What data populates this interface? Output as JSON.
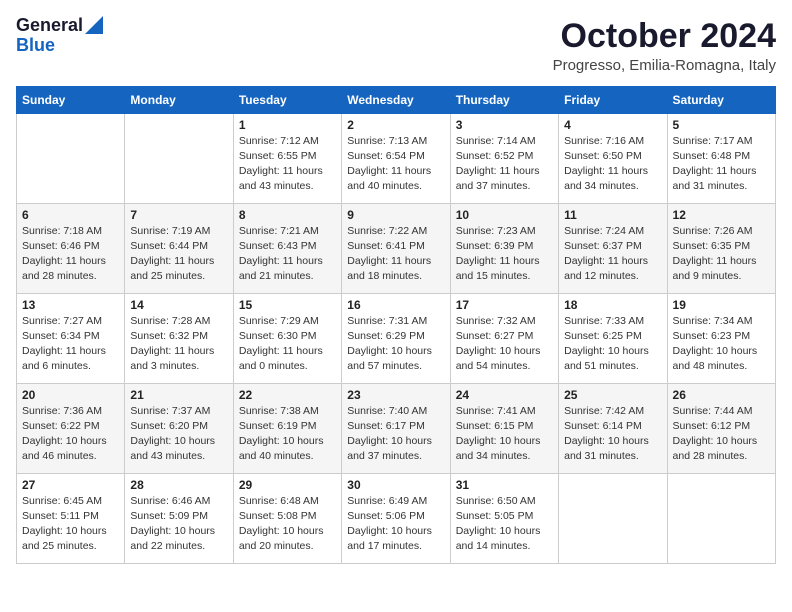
{
  "header": {
    "logo_general": "General",
    "logo_blue": "Blue",
    "month_title": "October 2024",
    "location": "Progresso, Emilia-Romagna, Italy"
  },
  "days_of_week": [
    "Sunday",
    "Monday",
    "Tuesday",
    "Wednesday",
    "Thursday",
    "Friday",
    "Saturday"
  ],
  "weeks": [
    [
      {
        "day": "",
        "sunrise": "",
        "sunset": "",
        "daylight": ""
      },
      {
        "day": "",
        "sunrise": "",
        "sunset": "",
        "daylight": ""
      },
      {
        "day": "1",
        "sunrise": "Sunrise: 7:12 AM",
        "sunset": "Sunset: 6:55 PM",
        "daylight": "Daylight: 11 hours and 43 minutes."
      },
      {
        "day": "2",
        "sunrise": "Sunrise: 7:13 AM",
        "sunset": "Sunset: 6:54 PM",
        "daylight": "Daylight: 11 hours and 40 minutes."
      },
      {
        "day": "3",
        "sunrise": "Sunrise: 7:14 AM",
        "sunset": "Sunset: 6:52 PM",
        "daylight": "Daylight: 11 hours and 37 minutes."
      },
      {
        "day": "4",
        "sunrise": "Sunrise: 7:16 AM",
        "sunset": "Sunset: 6:50 PM",
        "daylight": "Daylight: 11 hours and 34 minutes."
      },
      {
        "day": "5",
        "sunrise": "Sunrise: 7:17 AM",
        "sunset": "Sunset: 6:48 PM",
        "daylight": "Daylight: 11 hours and 31 minutes."
      }
    ],
    [
      {
        "day": "6",
        "sunrise": "Sunrise: 7:18 AM",
        "sunset": "Sunset: 6:46 PM",
        "daylight": "Daylight: 11 hours and 28 minutes."
      },
      {
        "day": "7",
        "sunrise": "Sunrise: 7:19 AM",
        "sunset": "Sunset: 6:44 PM",
        "daylight": "Daylight: 11 hours and 25 minutes."
      },
      {
        "day": "8",
        "sunrise": "Sunrise: 7:21 AM",
        "sunset": "Sunset: 6:43 PM",
        "daylight": "Daylight: 11 hours and 21 minutes."
      },
      {
        "day": "9",
        "sunrise": "Sunrise: 7:22 AM",
        "sunset": "Sunset: 6:41 PM",
        "daylight": "Daylight: 11 hours and 18 minutes."
      },
      {
        "day": "10",
        "sunrise": "Sunrise: 7:23 AM",
        "sunset": "Sunset: 6:39 PM",
        "daylight": "Daylight: 11 hours and 15 minutes."
      },
      {
        "day": "11",
        "sunrise": "Sunrise: 7:24 AM",
        "sunset": "Sunset: 6:37 PM",
        "daylight": "Daylight: 11 hours and 12 minutes."
      },
      {
        "day": "12",
        "sunrise": "Sunrise: 7:26 AM",
        "sunset": "Sunset: 6:35 PM",
        "daylight": "Daylight: 11 hours and 9 minutes."
      }
    ],
    [
      {
        "day": "13",
        "sunrise": "Sunrise: 7:27 AM",
        "sunset": "Sunset: 6:34 PM",
        "daylight": "Daylight: 11 hours and 6 minutes."
      },
      {
        "day": "14",
        "sunrise": "Sunrise: 7:28 AM",
        "sunset": "Sunset: 6:32 PM",
        "daylight": "Daylight: 11 hours and 3 minutes."
      },
      {
        "day": "15",
        "sunrise": "Sunrise: 7:29 AM",
        "sunset": "Sunset: 6:30 PM",
        "daylight": "Daylight: 11 hours and 0 minutes."
      },
      {
        "day": "16",
        "sunrise": "Sunrise: 7:31 AM",
        "sunset": "Sunset: 6:29 PM",
        "daylight": "Daylight: 10 hours and 57 minutes."
      },
      {
        "day": "17",
        "sunrise": "Sunrise: 7:32 AM",
        "sunset": "Sunset: 6:27 PM",
        "daylight": "Daylight: 10 hours and 54 minutes."
      },
      {
        "day": "18",
        "sunrise": "Sunrise: 7:33 AM",
        "sunset": "Sunset: 6:25 PM",
        "daylight": "Daylight: 10 hours and 51 minutes."
      },
      {
        "day": "19",
        "sunrise": "Sunrise: 7:34 AM",
        "sunset": "Sunset: 6:23 PM",
        "daylight": "Daylight: 10 hours and 48 minutes."
      }
    ],
    [
      {
        "day": "20",
        "sunrise": "Sunrise: 7:36 AM",
        "sunset": "Sunset: 6:22 PM",
        "daylight": "Daylight: 10 hours and 46 minutes."
      },
      {
        "day": "21",
        "sunrise": "Sunrise: 7:37 AM",
        "sunset": "Sunset: 6:20 PM",
        "daylight": "Daylight: 10 hours and 43 minutes."
      },
      {
        "day": "22",
        "sunrise": "Sunrise: 7:38 AM",
        "sunset": "Sunset: 6:19 PM",
        "daylight": "Daylight: 10 hours and 40 minutes."
      },
      {
        "day": "23",
        "sunrise": "Sunrise: 7:40 AM",
        "sunset": "Sunset: 6:17 PM",
        "daylight": "Daylight: 10 hours and 37 minutes."
      },
      {
        "day": "24",
        "sunrise": "Sunrise: 7:41 AM",
        "sunset": "Sunset: 6:15 PM",
        "daylight": "Daylight: 10 hours and 34 minutes."
      },
      {
        "day": "25",
        "sunrise": "Sunrise: 7:42 AM",
        "sunset": "Sunset: 6:14 PM",
        "daylight": "Daylight: 10 hours and 31 minutes."
      },
      {
        "day": "26",
        "sunrise": "Sunrise: 7:44 AM",
        "sunset": "Sunset: 6:12 PM",
        "daylight": "Daylight: 10 hours and 28 minutes."
      }
    ],
    [
      {
        "day": "27",
        "sunrise": "Sunrise: 6:45 AM",
        "sunset": "Sunset: 5:11 PM",
        "daylight": "Daylight: 10 hours and 25 minutes."
      },
      {
        "day": "28",
        "sunrise": "Sunrise: 6:46 AM",
        "sunset": "Sunset: 5:09 PM",
        "daylight": "Daylight: 10 hours and 22 minutes."
      },
      {
        "day": "29",
        "sunrise": "Sunrise: 6:48 AM",
        "sunset": "Sunset: 5:08 PM",
        "daylight": "Daylight: 10 hours and 20 minutes."
      },
      {
        "day": "30",
        "sunrise": "Sunrise: 6:49 AM",
        "sunset": "Sunset: 5:06 PM",
        "daylight": "Daylight: 10 hours and 17 minutes."
      },
      {
        "day": "31",
        "sunrise": "Sunrise: 6:50 AM",
        "sunset": "Sunset: 5:05 PM",
        "daylight": "Daylight: 10 hours and 14 minutes."
      },
      {
        "day": "",
        "sunrise": "",
        "sunset": "",
        "daylight": ""
      },
      {
        "day": "",
        "sunrise": "",
        "sunset": "",
        "daylight": ""
      }
    ]
  ]
}
